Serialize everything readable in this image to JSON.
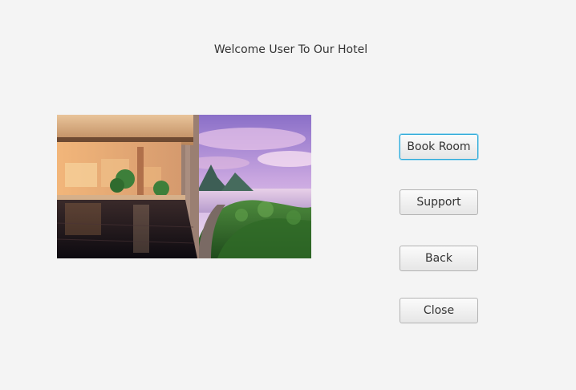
{
  "header": {
    "title": "Welcome User To Our Hotel"
  },
  "hero": {
    "image_desc": "hotel-infinity-pool-view"
  },
  "actions": {
    "book_room": "Book Room",
    "support": "Support",
    "back": "Back",
    "close": "Close"
  },
  "colors": {
    "background": "#f4f4f4",
    "focus_ring": "#2aa8d8",
    "text": "#333333"
  }
}
